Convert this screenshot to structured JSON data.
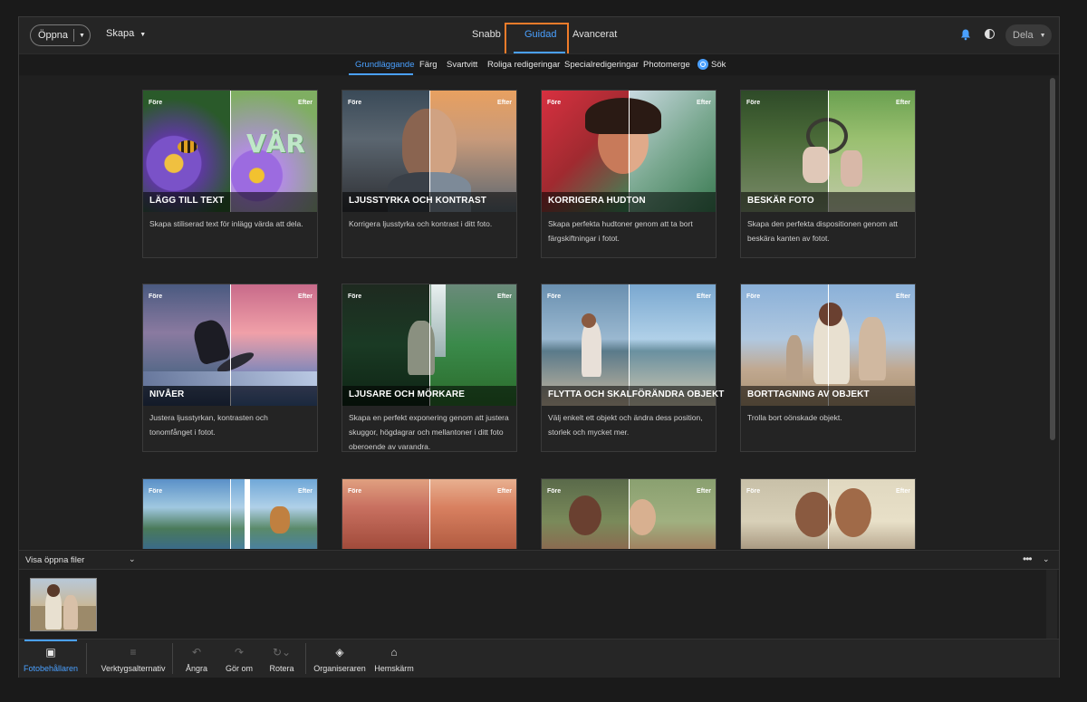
{
  "topbar": {
    "open_label": "Öppna",
    "create_label": "Skapa",
    "modes": [
      "Snabb",
      "Guidad",
      "Avancerat"
    ],
    "active_mode": "Guidad",
    "share_label": "Dela",
    "accent_color": "#4aa0ff",
    "highlight_color": "#f07c2a"
  },
  "categories": {
    "items": [
      "Grundläggande",
      "Färg",
      "Svartvitt",
      "Roliga redigeringar",
      "Specialredigeringar",
      "Photomerge"
    ],
    "active": "Grundläggande",
    "search_label": "Sök"
  },
  "cards": [
    {
      "before": "Före",
      "after": "Efter",
      "title": "LÄGG TILL TEXT",
      "desc": "Skapa stiliserad text för inlägg värda att dela.",
      "overlay_text": "VÅR"
    },
    {
      "before": "Före",
      "after": "Efter",
      "title": "LJUSSTYRKA OCH KONTRAST",
      "desc": "Korrigera ljusstyrka och kontrast i ditt foto."
    },
    {
      "before": "Före",
      "after": "Efter",
      "title": "KORRIGERA HUDTON",
      "desc": "Skapa perfekta hudtoner genom att ta bort färgskiftningar i fotot."
    },
    {
      "before": "Före",
      "after": "Efter",
      "title": "BESKÄR FOTO",
      "desc": "Skapa den perfekta dispositionen genom att beskära kanten av fotot."
    },
    {
      "before": "Före",
      "after": "Efter",
      "title": "NIVÅER",
      "desc": "Justera ljusstyrkan, kontrasten och tonomfånget i fotot."
    },
    {
      "before": "Före",
      "after": "Efter",
      "title": "LJUSARE OCH MÖRKARE",
      "desc": "Skapa en perfekt exponering genom att justera skuggor, högdagrar och mellantoner i ditt foto oberoende av varandra."
    },
    {
      "before": "Före",
      "after": "Efter",
      "title": "FLYTTA OCH SKALFÖRÄNDRA OBJEKT",
      "desc": "Välj enkelt ett objekt och ändra dess position, storlek och mycket mer."
    },
    {
      "before": "Före",
      "after": "Efter",
      "title": "BORTTAGNING AV OBJEKT",
      "desc": "Trolla bort oönskade objekt."
    },
    {
      "before": "Före",
      "after": "Efter"
    },
    {
      "before": "Före",
      "after": "Efter"
    },
    {
      "before": "Före",
      "after": "Efter"
    },
    {
      "before": "Före",
      "after": "Efter"
    }
  ],
  "filebar": {
    "label": "Visa öppna filer"
  },
  "toolbar": {
    "items": [
      {
        "label": "Fotobehållaren",
        "icon": "photo-bin-icon",
        "active": true
      },
      {
        "label": "Verktygsalternativ",
        "icon": "tool-options-icon"
      },
      {
        "label": "Ångra",
        "icon": "undo-icon"
      },
      {
        "label": "Gör om",
        "icon": "redo-icon"
      },
      {
        "label": "Rotera",
        "icon": "rotate-icon"
      },
      {
        "label": "Organiseraren",
        "icon": "organizer-icon"
      },
      {
        "label": "Hemskärm",
        "icon": "home-icon"
      }
    ]
  }
}
